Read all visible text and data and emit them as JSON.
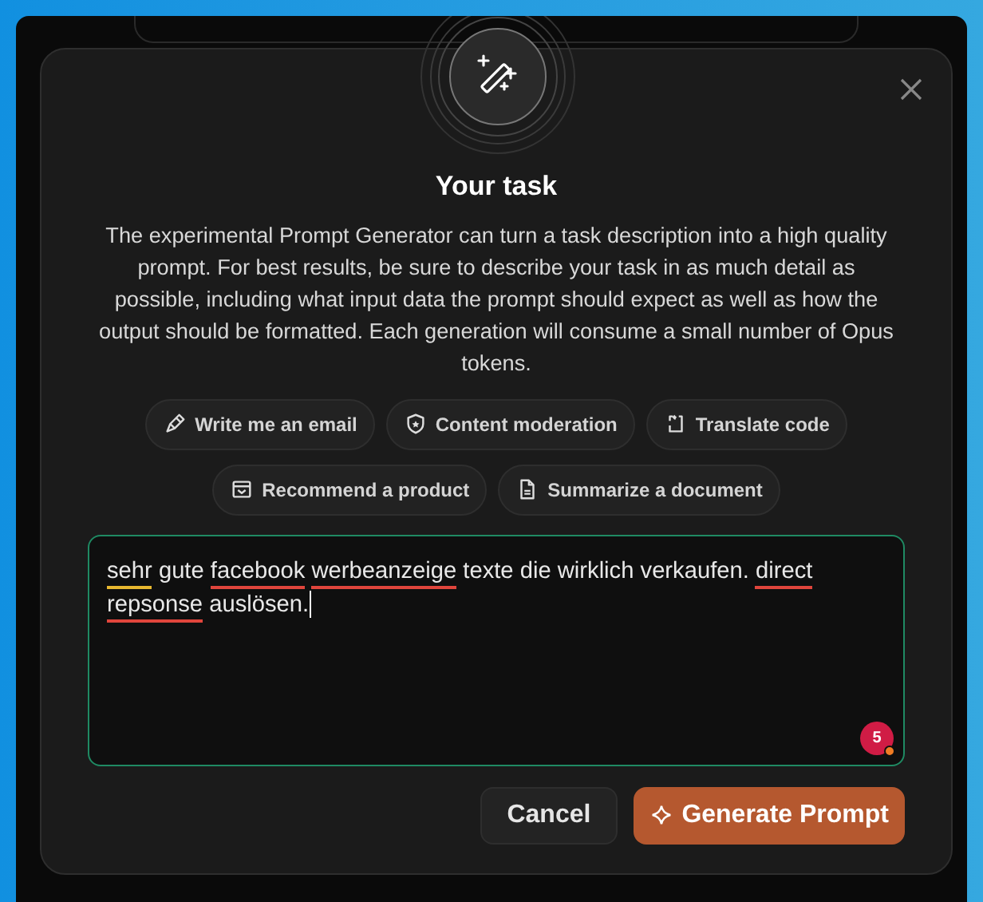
{
  "dialog": {
    "title": "Your task",
    "description": "The experimental Prompt Generator can turn a task description into a high quality prompt. For best results, be sure to describe your task in as much detail as possible, including what input data the prompt should expect as well as how the output should be formatted. Each generation will consume a small number of Opus tokens.",
    "suggestions": [
      {
        "label": "Write me an email",
        "kind": "pen"
      },
      {
        "label": "Content moderation",
        "kind": "shield"
      },
      {
        "label": "Translate code",
        "kind": "code"
      },
      {
        "label": "Recommend a product",
        "kind": "inbox"
      },
      {
        "label": "Summarize a document",
        "kind": "document"
      }
    ],
    "input": {
      "segments": [
        {
          "text": "sehr",
          "spelling_error": false,
          "grammar_warning": true
        },
        {
          "text": "gute",
          "spelling_error": false,
          "grammar_warning": false
        },
        {
          "text": "facebook",
          "spelling_error": true,
          "grammar_warning": false
        },
        {
          "text": "werbeanzeige",
          "spelling_error": true,
          "grammar_warning": false
        },
        {
          "text": "texte die wirklich verkaufen.",
          "spelling_error": false,
          "grammar_warning": false
        },
        {
          "text": "direct",
          "spelling_error": true,
          "grammar_warning": false
        },
        {
          "text": "repsonse",
          "spelling_error": true,
          "grammar_warning": false
        },
        {
          "text": "auslösen.",
          "spelling_error": false,
          "grammar_warning": false
        }
      ],
      "badge": "5"
    },
    "buttons": [
      {
        "label": "Cancel",
        "kind": "secondary"
      },
      {
        "label": "Generate Prompt",
        "kind": "primary"
      }
    ]
  }
}
